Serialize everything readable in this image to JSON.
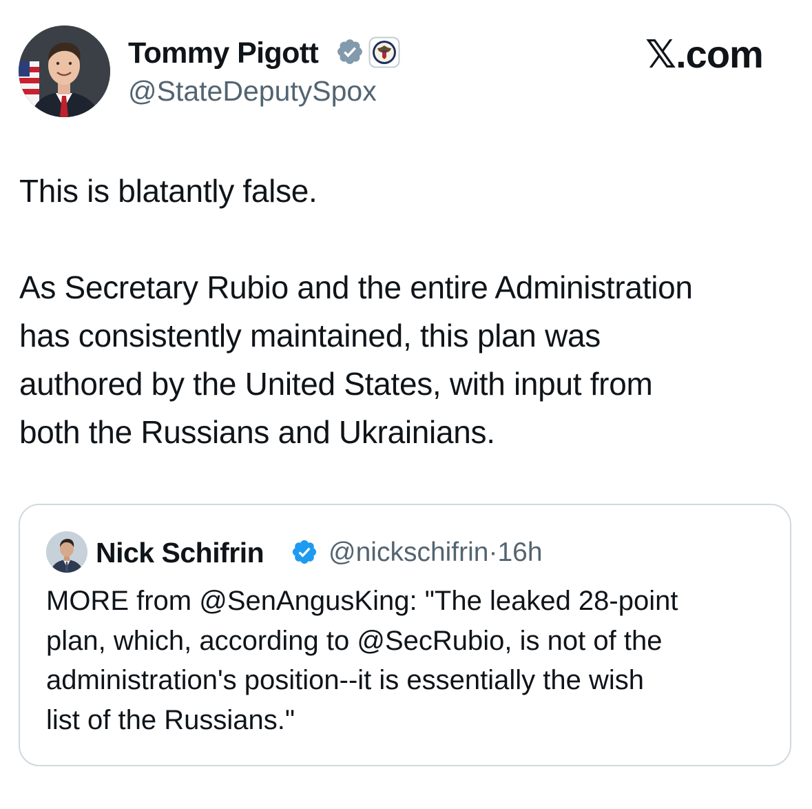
{
  "tweet": {
    "author": {
      "name": "Tommy Pigott",
      "handle": "@StateDeputySpox",
      "avatar_icon": "person-portrait-flag",
      "badges": [
        "verified-check-icon",
        "state-department-seal-icon"
      ]
    },
    "brand": {
      "logo_letter": "𝕏",
      "logo_suffix": ".com"
    },
    "text": {
      "paragraph_1": "This is blatantly false.",
      "paragraph_2_lines": [
        "As Secretary Rubio and the entire Administration",
        "has consistently maintained, this plan was",
        "authored by the United States, with input from",
        "both the Russians and Ukrainians."
      ]
    }
  },
  "quoted_tweet": {
    "author": {
      "name": "Nick Schifrin",
      "handle": "@nickschifrin",
      "separator": "·",
      "time": "16h",
      "avatar_icon": "person-portrait"
    },
    "text_lines": [
      "MORE from @SenAngusKing: \"The leaked 28-point",
      "plan, which, according to @SecRubio, is not of the",
      "administration's position--it is essentially the wish",
      "list of the Russians.\""
    ]
  },
  "colors": {
    "text_primary": "#0f1419",
    "text_secondary": "#536471",
    "verified_blue": "#1d9bf0",
    "gov_badge_gray": "#829aab",
    "card_border": "#cfd9de"
  }
}
